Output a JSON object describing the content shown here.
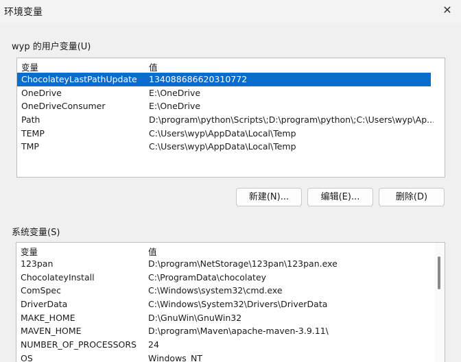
{
  "window": {
    "title": "环境变量",
    "close_glyph": "✕"
  },
  "user_vars": {
    "group_label": "wyp 的用户变量(U)",
    "header": {
      "name": "变量",
      "value": "值"
    },
    "rows": [
      {
        "name": "ChocolateyLastPathUpdate",
        "value": "134088686620310772",
        "selected": true
      },
      {
        "name": "OneDrive",
        "value": "E:\\OneDrive"
      },
      {
        "name": "OneDriveConsumer",
        "value": "E:\\OneDrive"
      },
      {
        "name": "Path",
        "value": "D:\\program\\python\\Scripts\\;D:\\program\\python\\;C:\\Users\\wyp\\Ap..."
      },
      {
        "name": "TEMP",
        "value": "C:\\Users\\wyp\\AppData\\Local\\Temp"
      },
      {
        "name": "TMP",
        "value": "C:\\Users\\wyp\\AppData\\Local\\Temp"
      }
    ],
    "buttons": {
      "new": "新建(N)...",
      "edit": "编辑(E)...",
      "delete": "删除(D)"
    }
  },
  "system_vars": {
    "group_label": "系统变量(S)",
    "header": {
      "name": "变量",
      "value": "值"
    },
    "rows": [
      {
        "name": "123pan",
        "value": "D:\\program\\NetStorage\\123pan\\123pan.exe"
      },
      {
        "name": "ChocolateyInstall",
        "value": "C:\\ProgramData\\chocolatey"
      },
      {
        "name": "ComSpec",
        "value": "C:\\Windows\\system32\\cmd.exe"
      },
      {
        "name": "DriverData",
        "value": "C:\\Windows\\System32\\Drivers\\DriverData"
      },
      {
        "name": "MAKE_HOME",
        "value": "D:\\GnuWin\\GnuWin32"
      },
      {
        "name": "MAVEN_HOME",
        "value": "D:\\program\\Maven\\apache-maven-3.9.11\\"
      },
      {
        "name": "NUMBER_OF_PROCESSORS",
        "value": "24"
      },
      {
        "name": "OS",
        "value": "Windows_NT"
      }
    ]
  },
  "colors": {
    "selection": "#0a6ccd",
    "background": "#f0f0f0"
  }
}
